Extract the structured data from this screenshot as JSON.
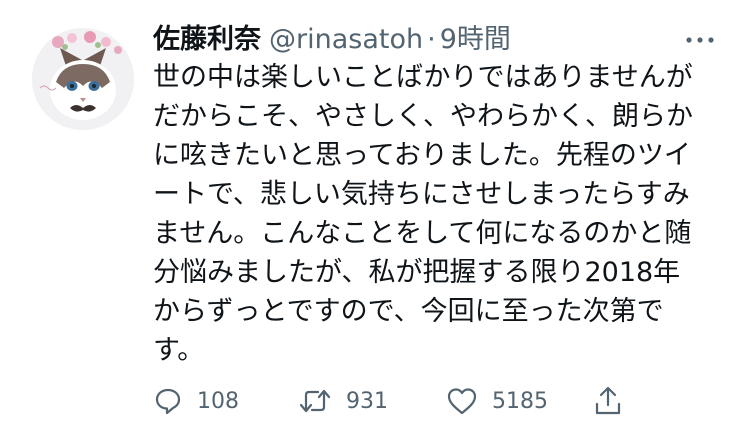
{
  "tweet": {
    "author": {
      "display_name": "佐藤利奈",
      "handle": "@rinasatoh",
      "separator": "·",
      "time": "9時間"
    },
    "body_lines": [
      "世の中は楽しいことばかりではありませんが",
      "だからこそ、やさしく、やわらかく、朗らか",
      "に呟きたいと思っておりました。先程のツイ",
      "ートで、悲しい気持ちにさせしまったらすみ",
      "ません。こんなことをして何になるのかと随",
      "分悩みましたが、私が把握する限り2018年",
      "からずっとですので、今回に至った次第で",
      "す。"
    ],
    "stats": {
      "replies": "108",
      "retweets": "931",
      "likes": "5185"
    },
    "icons": {
      "avatar": "cat-avatar",
      "more": "more-icon",
      "reply": "reply-icon",
      "retweet": "retweet-icon",
      "like": "heart-icon",
      "share": "share-icon"
    },
    "colors": {
      "text": "#0f1419",
      "secondary": "#536471",
      "background": "#ffffff"
    }
  }
}
